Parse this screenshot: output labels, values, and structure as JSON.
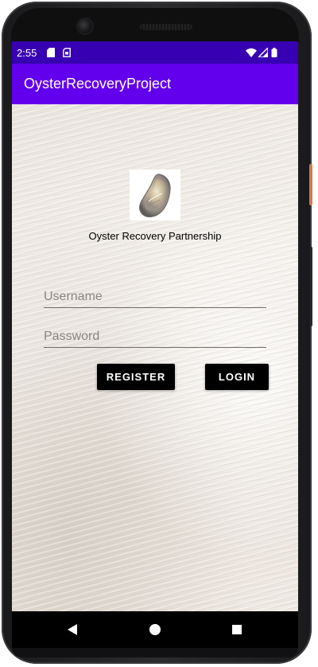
{
  "status_bar": {
    "time": "2:55",
    "left_icons": [
      "sd-card-icon",
      "sim-card-icon"
    ],
    "right_icons": [
      "wifi-icon",
      "cellular-signal-icon",
      "battery-icon"
    ]
  },
  "app_bar": {
    "title": "OysterRecoveryProject",
    "color": "#6200ee",
    "status_color": "#3700b3"
  },
  "login": {
    "logo_icon": "oyster-shell-logo-icon",
    "organization_name": "Oyster Recovery Partnership",
    "username": {
      "placeholder": "Username",
      "value": ""
    },
    "password": {
      "placeholder": "Password",
      "value": ""
    },
    "register_label": "REGISTER",
    "login_label": "LOGIN",
    "button_color": "#000000"
  },
  "nav_bar": {
    "icons": [
      "back-icon",
      "home-icon",
      "recents-icon"
    ]
  }
}
